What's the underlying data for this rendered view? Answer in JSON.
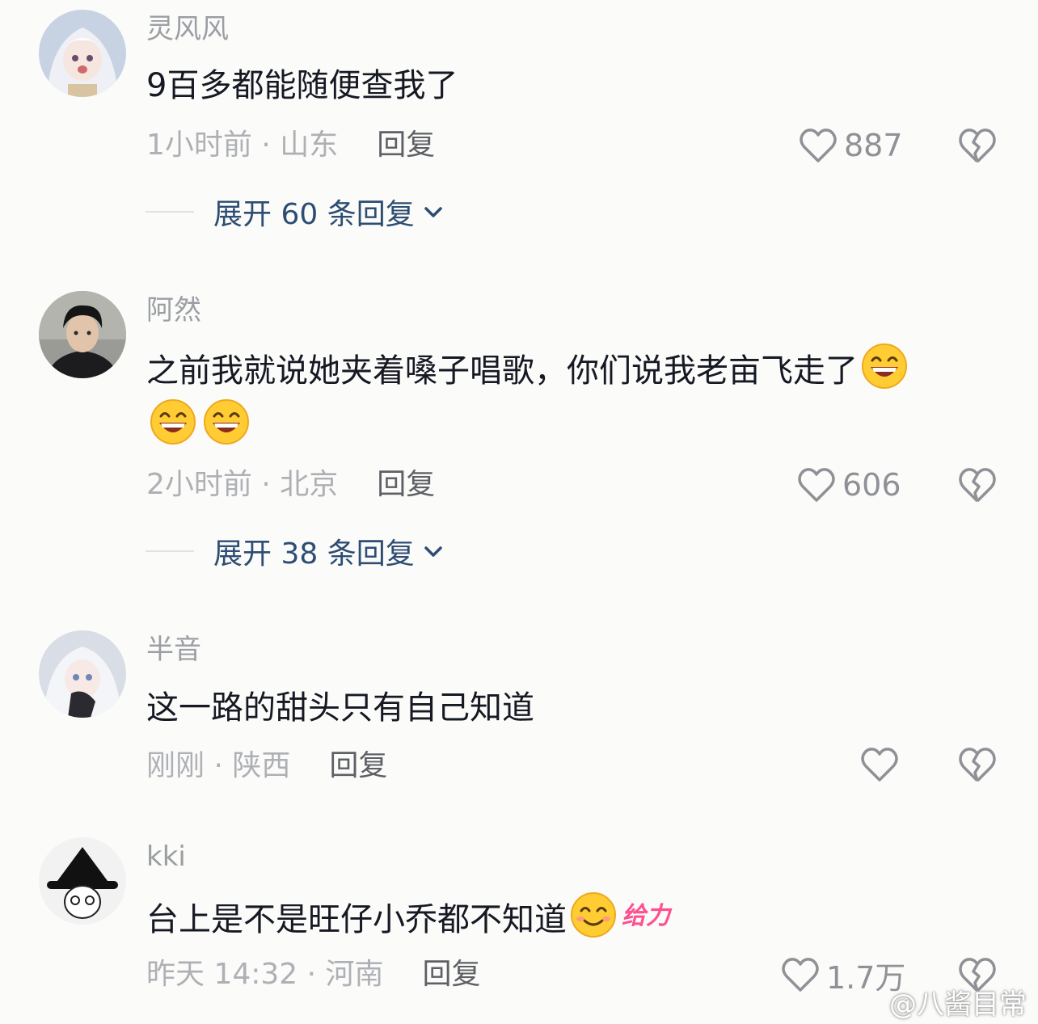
{
  "comments": [
    {
      "username": "灵风风",
      "text": "9百多都能随便查我了",
      "time_location": "1小时前 · 山东",
      "reply_label": "回复",
      "likes": "887",
      "expand_label": "展开 60 条回复"
    },
    {
      "username": "阿然",
      "text": "之前我就说她夹着嗓子唱歌，你们说我老亩飞走了",
      "time_location": "2小时前 · 北京",
      "reply_label": "回复",
      "likes": "606",
      "expand_label": "展开 38 条回复"
    },
    {
      "username": "半音",
      "text": "这一路的甜头只有自己知道",
      "time_location": "刚刚 · 陕西",
      "reply_label": "回复",
      "likes": ""
    },
    {
      "username": "kki",
      "text": "台上是不是旺仔小乔都不知道",
      "emoji_text": "给力",
      "time_location": "昨天 14:32 · 河南",
      "reply_label": "回复",
      "likes": "1.7万"
    }
  ],
  "watermark": "@八酱目常",
  "colors": {
    "background": "#fbfbf9",
    "text_primary": "#161823",
    "text_secondary": "#9b9ea3",
    "expand_link": "#2d4d73",
    "icon_gray": "#8f9197"
  },
  "icons": [
    "heart-outline-icon",
    "broken-heart-icon",
    "chevron-down-icon",
    "grin-emoji",
    "smile-emoji"
  ]
}
